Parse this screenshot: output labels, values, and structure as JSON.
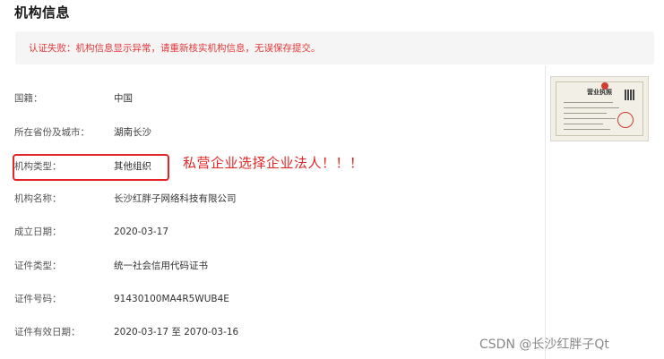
{
  "header": {
    "title": "机构信息"
  },
  "alert": {
    "message": "认证失败：机构信息显示异常，请重新核实机构信息，无误保存提交。"
  },
  "fields": [
    {
      "label": "国籍：",
      "value": "中国"
    },
    {
      "label": "所在省份及城市：",
      "value": "湖南长沙"
    },
    {
      "label": "机构类型：",
      "value": "其他组织"
    },
    {
      "label": "机构名称：",
      "value": "长沙红胖子网络科技有限公司"
    },
    {
      "label": "成立日期：",
      "value": "2020-03-17"
    },
    {
      "label": "证件类型：",
      "value": "统一社会信用代码证书"
    },
    {
      "label": "证件号码：",
      "value": "91430100MA4R5WUB4E"
    },
    {
      "label": "证件有效日期：",
      "value": "2020-03-17 至 2070-03-16"
    }
  ],
  "annotation": {
    "text": "私营企业选择企业法人！！！",
    "color": "#e32626"
  },
  "license_image": {
    "heading": "营业执照",
    "icon": "business-license-image"
  },
  "watermark": {
    "text": "CSDN @长沙红胖子Qt"
  },
  "colors": {
    "alert_text": "#e4393c",
    "alert_bg": "#f5f5f5",
    "annotation": "#e32626"
  }
}
